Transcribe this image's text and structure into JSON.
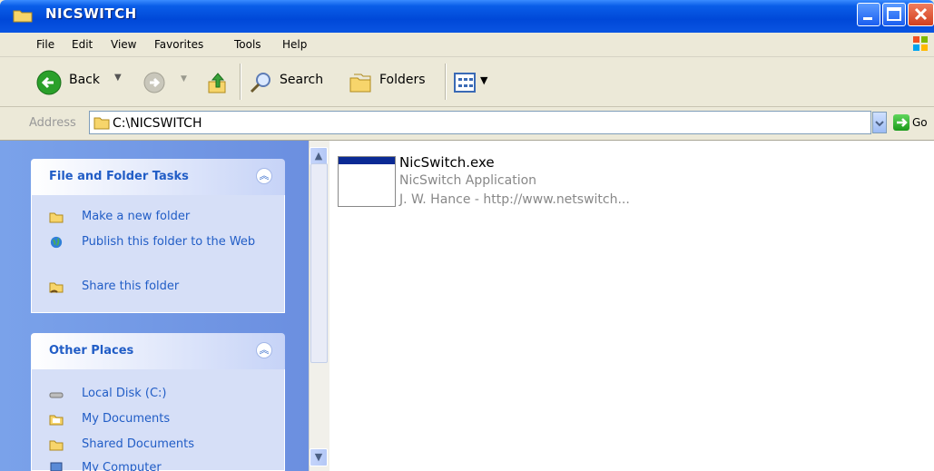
{
  "window": {
    "title": "NICSWITCH"
  },
  "menu": [
    "File",
    "Edit",
    "View",
    "Favorites",
    "Tools",
    "Help"
  ],
  "toolbar": {
    "back_label": "Back",
    "search_label": "Search",
    "folders_label": "Folders"
  },
  "address": {
    "label": "Address",
    "value": "C:\\NICSWITCH",
    "go_label": "Go"
  },
  "tasks_panel": {
    "title": "File and Folder Tasks",
    "items": [
      {
        "label": "Make a new folder",
        "icon": "new-folder-icon"
      },
      {
        "label": "Publish this folder to the Web",
        "icon": "globe-icon"
      },
      {
        "label": "Share this folder",
        "icon": "share-folder-icon"
      }
    ]
  },
  "places_panel": {
    "title": "Other Places",
    "items": [
      {
        "label": "Local Disk (C:)",
        "icon": "disk-icon"
      },
      {
        "label": "My Documents",
        "icon": "documents-folder-icon"
      },
      {
        "label": "Shared Documents",
        "icon": "shared-folder-icon"
      },
      {
        "label": "My Computer",
        "icon": "computer-icon"
      }
    ]
  },
  "files": [
    {
      "name": "NicSwitch.exe",
      "type": "NicSwitch Application",
      "description": "J. W. Hance - http://www.netswitch..."
    }
  ],
  "colors": {
    "titlebar": "#0a55e2",
    "taskpane": "#7aa2ea",
    "link": "#215dc6"
  }
}
